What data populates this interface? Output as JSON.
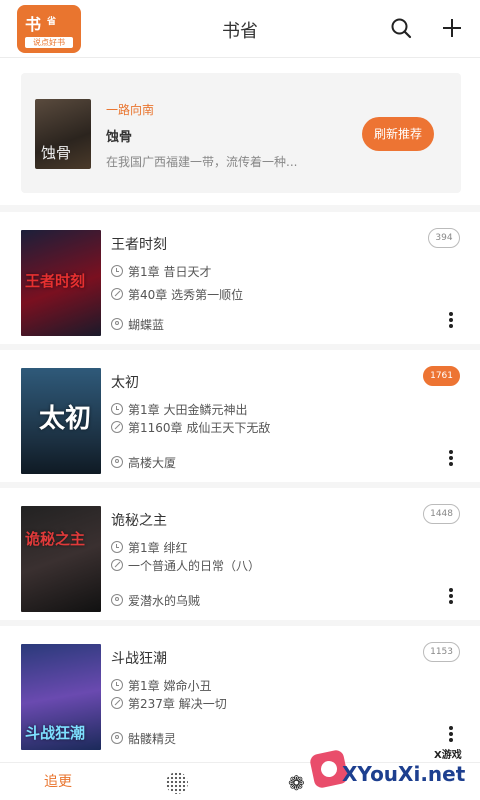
{
  "header": {
    "logo_text_main": "书",
    "logo_text_side": "省",
    "logo_subtext": "说点好书",
    "title": "书省",
    "search_icon": "search-icon",
    "add_icon": "plus-icon"
  },
  "recommend": {
    "tag": "一路向南",
    "book_title": "蚀骨",
    "cover_text": "蚀骨",
    "description": "在我国广西福建一带，流传着一种...",
    "refresh_label": "刷新推荐"
  },
  "books": [
    {
      "title": "王者时刻",
      "first_chapter": "第1章 昔日天才",
      "latest_chapter": "第40章 选秀第一顺位",
      "author": "蝴蝶蓝",
      "badge": "394",
      "cover_text": "王者时刻",
      "badge_hot": false
    },
    {
      "title": "太初",
      "first_chapter": "第1章 大田金鳞元神出",
      "latest_chapter": "第1160章 成仙王天下无敌",
      "author": "高楼大厦",
      "badge": "1761",
      "cover_text": "太初",
      "badge_hot": true
    },
    {
      "title": "诡秘之主",
      "first_chapter": "第1章 绯红",
      "latest_chapter": "一个普通人的日常（八）",
      "author": "爱潜水的乌贼",
      "badge": "1448",
      "cover_text": "诡秘之主",
      "badge_hot": false
    },
    {
      "title": "斗战狂潮",
      "first_chapter": "第1章 嫦命小丑",
      "latest_chapter": "第237章 解决一切",
      "author": "骷髅精灵",
      "badge": "1153",
      "cover_text": "斗战狂潮",
      "badge_hot": false
    }
  ],
  "nav": {
    "tab1_label": "追更",
    "tab2_icon": "dot-grid-icon",
    "tab3_icon": "paw-icon"
  },
  "watermark": {
    "small": "X游戏",
    "text": "XYouXi.net"
  },
  "colors": {
    "accent": "#ed7433",
    "text": "#333333",
    "muted": "#888888"
  }
}
